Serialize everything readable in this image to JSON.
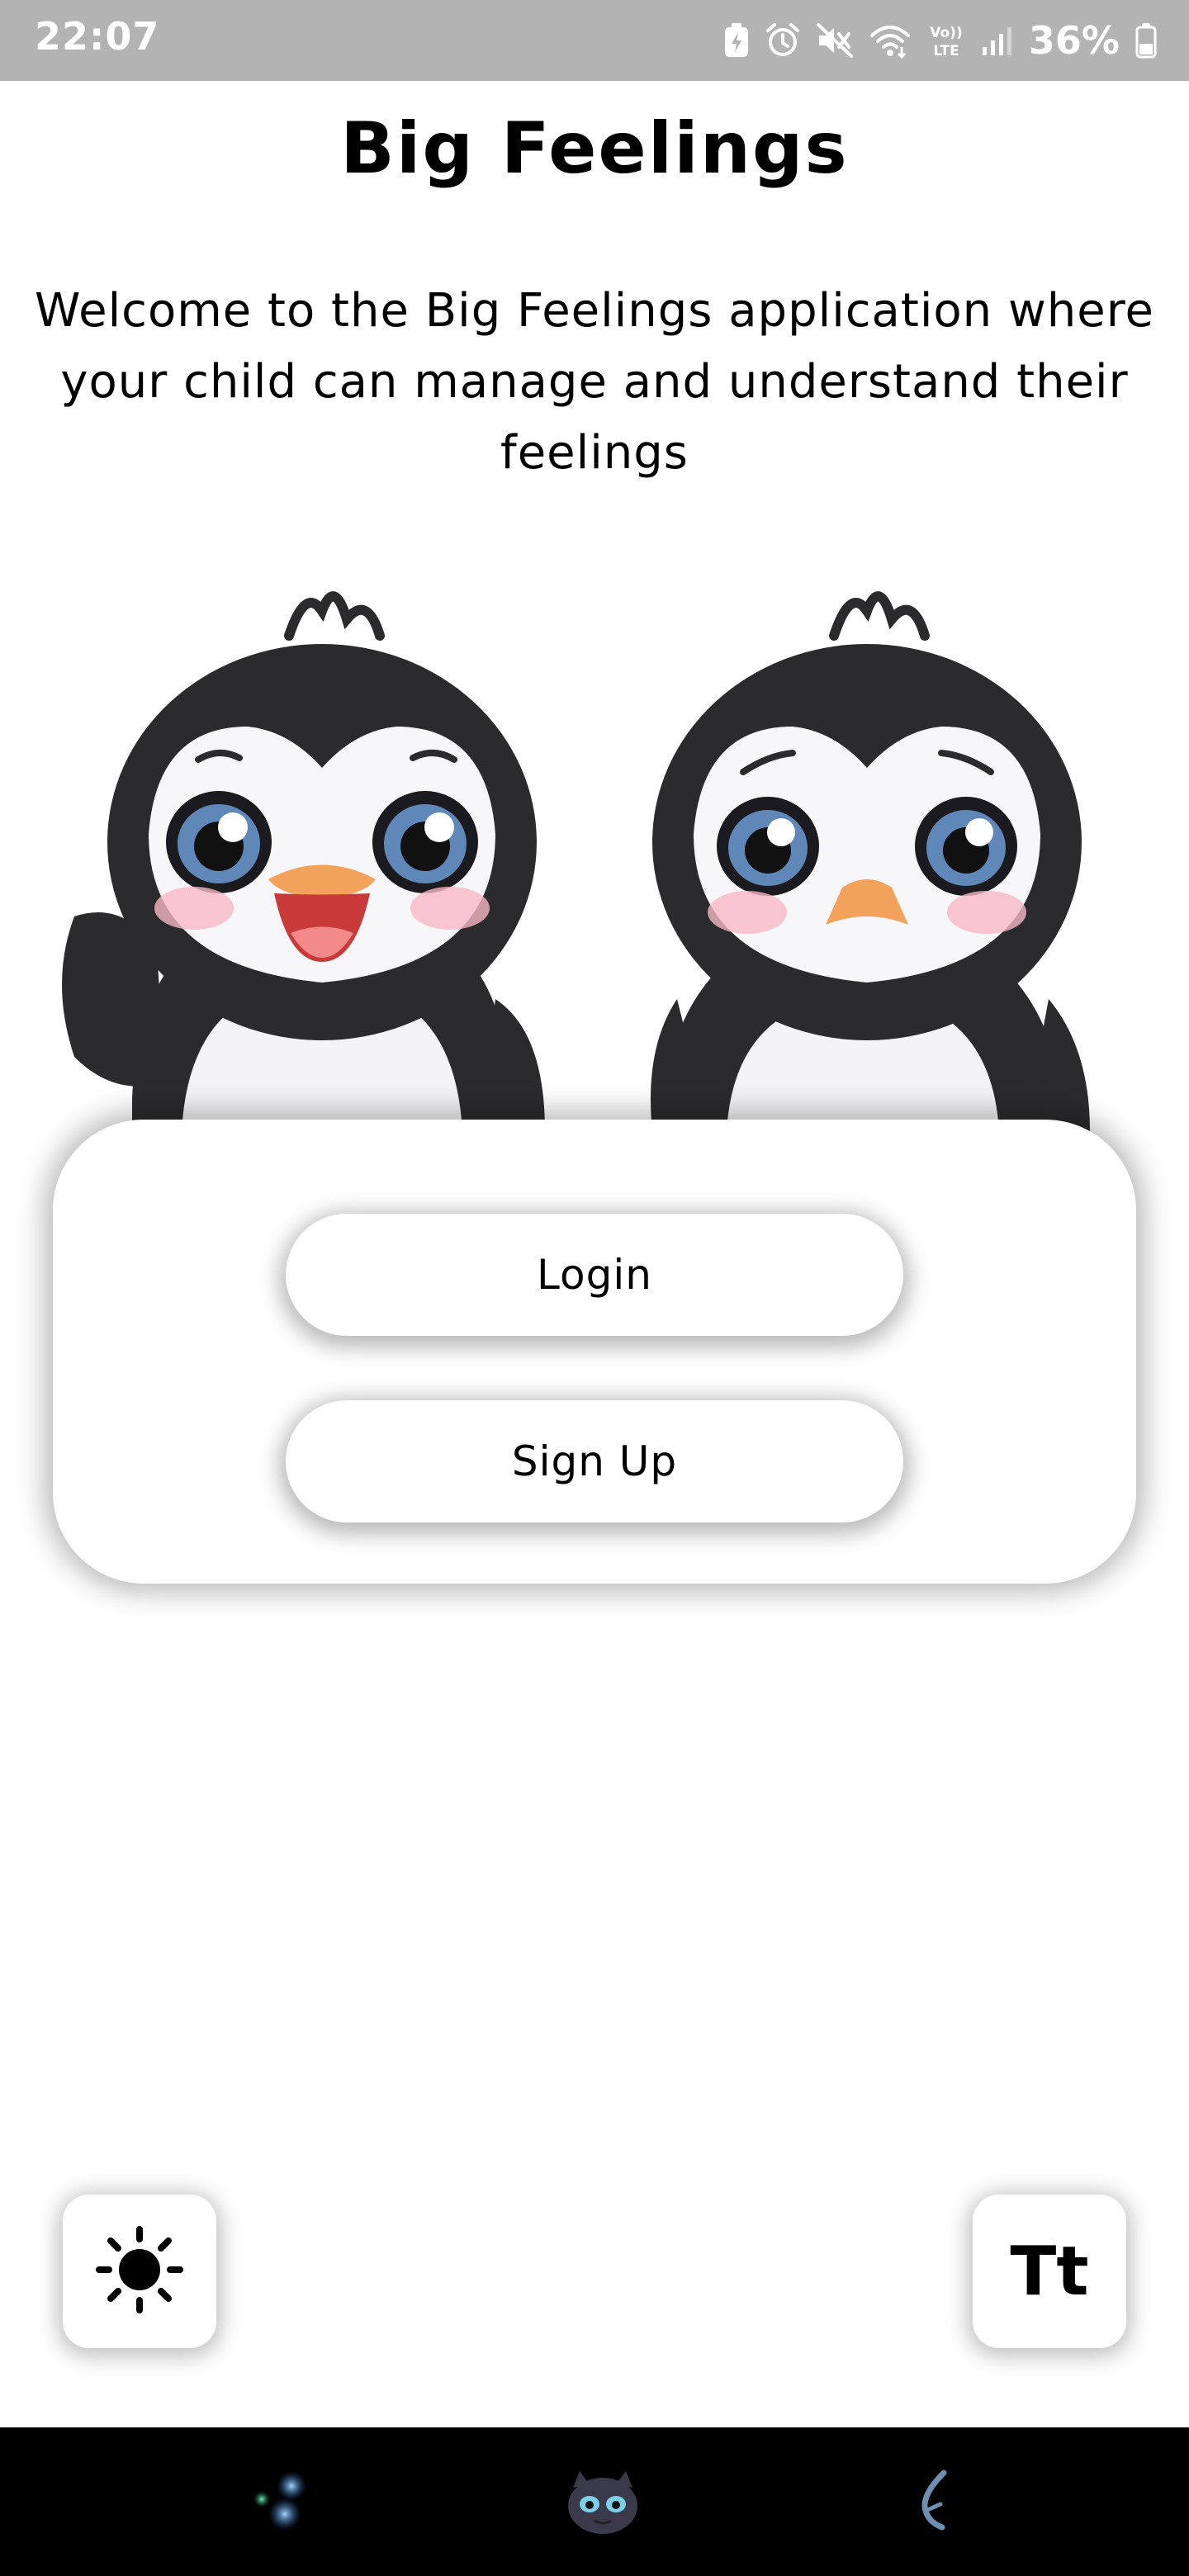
{
  "status_bar": {
    "time": "22:07",
    "battery_percent": "36%",
    "icons": [
      "battery-saver-icon",
      "alarm-icon",
      "mute-icon",
      "wifi-icon",
      "volte-icon",
      "signal-icon",
      "battery-icon"
    ],
    "volte_label_top": "Vo))",
    "volte_label_bottom": "LTE"
  },
  "header": {
    "title": "Big Feelings",
    "welcome": "Welcome to the Big Feelings application where your child can manage and understand their feelings"
  },
  "illustration": {
    "characters": [
      "happy-penguin",
      "worried-penguin"
    ]
  },
  "auth": {
    "login_label": "Login",
    "signup_label": "Sign Up"
  },
  "controls": {
    "theme_icon": "sun-icon",
    "text_size_label": "Tt"
  },
  "nav_bar": {
    "items": [
      "home-orbs-icon",
      "character-icon",
      "back-icon"
    ]
  },
  "colors": {
    "status_bar_bg": "#b3b3b3",
    "background": "#ffffff",
    "text": "#000000",
    "nav_bar_bg": "#000000",
    "penguin_dark": "#2b2b2e",
    "penguin_beak": "#f2a25a",
    "penguin_cheek": "#f6b8c4",
    "eye_blue": "#5f88b8"
  }
}
